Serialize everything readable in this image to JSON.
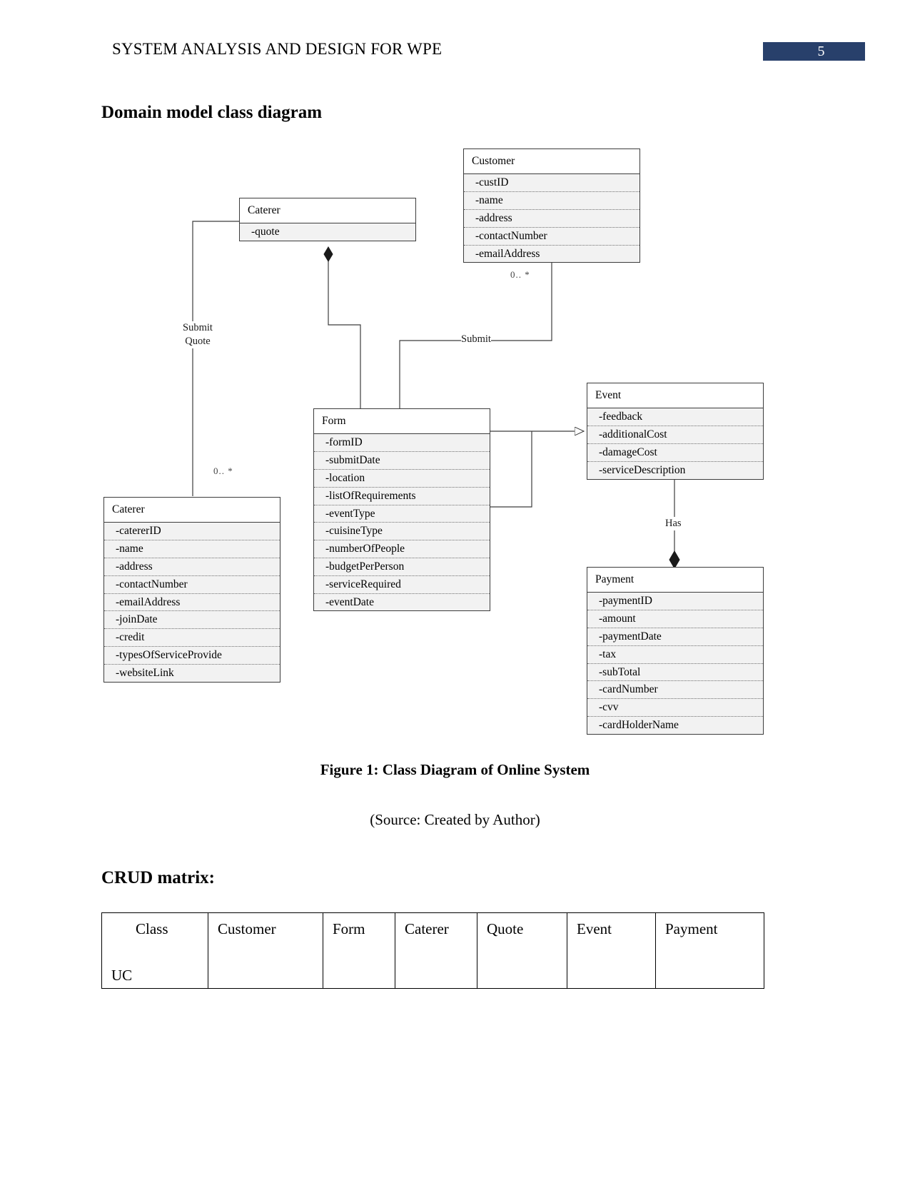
{
  "header": {
    "title": "SYSTEM ANALYSIS AND DESIGN FOR WPE",
    "page_number": "5",
    "badge_color": "#28406b"
  },
  "headings": {
    "domain_model": "Domain model class diagram",
    "crud_matrix": "CRUD matrix:"
  },
  "captions": {
    "figure": "Figure 1: Class Diagram of Online System",
    "source": "(Source: Created by Author)"
  },
  "diagram": {
    "classes": [
      {
        "id": "customer",
        "name": "Customer",
        "attributes": [
          "-custID",
          "-name",
          "-address",
          "-contactNumber",
          "-emailAddress"
        ]
      },
      {
        "id": "quote",
        "name": "Caterer",
        "attributes": [
          "-quote"
        ]
      },
      {
        "id": "caterer",
        "name": "Caterer",
        "attributes": [
          "-catererID",
          "-name",
          "-address",
          "-contactNumber",
          "-emailAddress",
          "-joinDate",
          "-credit",
          "-typesOfServiceProvide",
          "-websiteLink"
        ]
      },
      {
        "id": "form",
        "name": "Form",
        "attributes": [
          "-formID",
          "-submitDate",
          "-location",
          "-listOfRequirements",
          "-eventType",
          "-cuisineType",
          "-numberOfPeople",
          "-budgetPerPerson",
          "-serviceRequired",
          "-eventDate"
        ]
      },
      {
        "id": "event",
        "name": "Event",
        "attributes": [
          "-feedback",
          "-additionalCost",
          "-damageCost",
          "-serviceDescription"
        ]
      },
      {
        "id": "payment",
        "name": "Payment",
        "attributes": [
          "-paymentID",
          "-amount",
          "-paymentDate",
          "-tax",
          "-subTotal",
          "-cardNumber",
          "-cvv",
          "-cardHolderName"
        ]
      }
    ],
    "edge_labels": {
      "submit_quote_line1": "Submit",
      "submit_quote_line2": "Quote",
      "submit": "Submit",
      "has": "Has"
    },
    "multiplicities": {
      "customer_form": "0..  *",
      "caterer_quote": "0..  *"
    }
  },
  "crud": {
    "columns": [
      "Class",
      "Customer",
      "Form",
      "Caterer",
      "Quote",
      "Event",
      "Payment"
    ],
    "row_label": "UC",
    "rows": [
      [
        "",
        "",
        "",
        "",
        "",
        "",
        ""
      ]
    ]
  }
}
